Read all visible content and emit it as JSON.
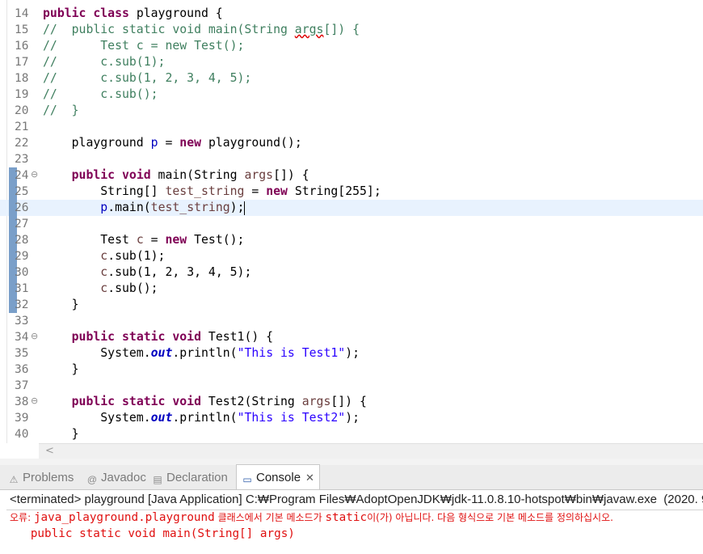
{
  "editor": {
    "current_line": "26",
    "lines": [
      {
        "num": "14",
        "tokens": [
          {
            "t": "kw",
            "v": "public class"
          },
          {
            "t": "p",
            "v": " playground {"
          }
        ]
      },
      {
        "num": "15",
        "tokens": [
          {
            "t": "cm",
            "v": "//  public static void main(String "
          },
          {
            "t": "cmsq",
            "v": "args"
          },
          {
            "t": "cm",
            "v": "[]) {"
          }
        ]
      },
      {
        "num": "16",
        "tokens": [
          {
            "t": "cm",
            "v": "//      Test c = new Test();"
          }
        ]
      },
      {
        "num": "17",
        "tokens": [
          {
            "t": "cm",
            "v": "//      c.sub(1);"
          }
        ]
      },
      {
        "num": "18",
        "tokens": [
          {
            "t": "cm",
            "v": "//      c.sub(1, 2, 3, 4, 5);"
          }
        ]
      },
      {
        "num": "19",
        "tokens": [
          {
            "t": "cm",
            "v": "//      c.sub();"
          }
        ]
      },
      {
        "num": "20",
        "tokens": [
          {
            "t": "cm",
            "v": "//  }"
          }
        ]
      },
      {
        "num": "21",
        "tokens": []
      },
      {
        "num": "22",
        "tokens": [
          {
            "t": "p",
            "v": "    playground "
          },
          {
            "t": "fld",
            "v": "p"
          },
          {
            "t": "p",
            "v": " = "
          },
          {
            "t": "kw",
            "v": "new"
          },
          {
            "t": "p",
            "v": " playground();"
          }
        ]
      },
      {
        "num": "23",
        "tokens": []
      },
      {
        "num": "24",
        "fold": true,
        "marker": true,
        "tokens": [
          {
            "t": "p",
            "v": "    "
          },
          {
            "t": "kw",
            "v": "public void"
          },
          {
            "t": "p",
            "v": " main(String "
          },
          {
            "t": "var",
            "v": "args"
          },
          {
            "t": "p",
            "v": "[]) {"
          }
        ]
      },
      {
        "num": "25",
        "marker": true,
        "tokens": [
          {
            "t": "p",
            "v": "        String[] "
          },
          {
            "t": "var",
            "v": "test_string"
          },
          {
            "t": "p",
            "v": " = "
          },
          {
            "t": "kw",
            "v": "new"
          },
          {
            "t": "p",
            "v": " String[255];"
          }
        ]
      },
      {
        "num": "26",
        "marker": true,
        "current": true,
        "tokens": [
          {
            "t": "p",
            "v": "        "
          },
          {
            "t": "fld",
            "v": "p"
          },
          {
            "t": "p",
            "v": ".main("
          },
          {
            "t": "var",
            "v": "test_string"
          },
          {
            "t": "p",
            "v": ");"
          },
          {
            "t": "caret",
            "v": ""
          }
        ]
      },
      {
        "num": "27",
        "marker": true,
        "tokens": []
      },
      {
        "num": "28",
        "marker": true,
        "tokens": [
          {
            "t": "p",
            "v": "        Test "
          },
          {
            "t": "var",
            "v": "c"
          },
          {
            "t": "p",
            "v": " = "
          },
          {
            "t": "kw",
            "v": "new"
          },
          {
            "t": "p",
            "v": " Test();"
          }
        ]
      },
      {
        "num": "29",
        "marker": true,
        "tokens": [
          {
            "t": "p",
            "v": "        "
          },
          {
            "t": "var",
            "v": "c"
          },
          {
            "t": "p",
            "v": ".sub(1);"
          }
        ]
      },
      {
        "num": "30",
        "marker": true,
        "tokens": [
          {
            "t": "p",
            "v": "        "
          },
          {
            "t": "var",
            "v": "c"
          },
          {
            "t": "p",
            "v": ".sub(1, 2, 3, 4, 5);"
          }
        ]
      },
      {
        "num": "31",
        "marker": true,
        "tokens": [
          {
            "t": "p",
            "v": "        "
          },
          {
            "t": "var",
            "v": "c"
          },
          {
            "t": "p",
            "v": ".sub();"
          }
        ]
      },
      {
        "num": "32",
        "marker": true,
        "tokens": [
          {
            "t": "p",
            "v": "    }"
          }
        ]
      },
      {
        "num": "33",
        "tokens": []
      },
      {
        "num": "34",
        "fold": true,
        "tokens": [
          {
            "t": "p",
            "v": "    "
          },
          {
            "t": "kw",
            "v": "public static void"
          },
          {
            "t": "p",
            "v": " Test1() {"
          }
        ]
      },
      {
        "num": "35",
        "tokens": [
          {
            "t": "p",
            "v": "        System."
          },
          {
            "t": "st",
            "v": "out"
          },
          {
            "t": "p",
            "v": ".println("
          },
          {
            "t": "str",
            "v": "\"This is Test1\""
          },
          {
            "t": "p",
            "v": ");"
          }
        ]
      },
      {
        "num": "36",
        "tokens": [
          {
            "t": "p",
            "v": "    }"
          }
        ]
      },
      {
        "num": "37",
        "tokens": []
      },
      {
        "num": "38",
        "fold": true,
        "tokens": [
          {
            "t": "p",
            "v": "    "
          },
          {
            "t": "kw",
            "v": "public static void"
          },
          {
            "t": "p",
            "v": " Test2(String "
          },
          {
            "t": "var",
            "v": "args"
          },
          {
            "t": "p",
            "v": "[]) {"
          }
        ]
      },
      {
        "num": "39",
        "tokens": [
          {
            "t": "p",
            "v": "        System."
          },
          {
            "t": "st",
            "v": "out"
          },
          {
            "t": "p",
            "v": ".println("
          },
          {
            "t": "str",
            "v": "\"This is Test2\""
          },
          {
            "t": "p",
            "v": ");"
          }
        ]
      },
      {
        "num": "40",
        "tokens": [
          {
            "t": "p",
            "v": "    }"
          }
        ]
      }
    ],
    "hscroll_left_glyph": "<"
  },
  "views": {
    "tabs": [
      {
        "name": "tab-problems",
        "icon": "problems-icon",
        "glyph": "⚠",
        "label": "Problems",
        "active": false
      },
      {
        "name": "tab-javadoc",
        "icon": "javadoc-icon",
        "glyph": "@",
        "label": "Javadoc",
        "active": false
      },
      {
        "name": "tab-declaration",
        "icon": "declaration-icon",
        "glyph": "▤",
        "label": "Declaration",
        "active": false
      },
      {
        "name": "tab-console",
        "icon": "console-icon",
        "glyph": "▭",
        "label": "Console",
        "active": true,
        "close": "✕"
      }
    ]
  },
  "console": {
    "header": "<terminated> playground [Java Application] C:₩Program Files₩AdoptOpenJDK₩jdk-11.0.8.10-hotspot₩bin₩javaw.exe  (2020. 9",
    "error_prefix": "오류: ",
    "error_class": "java_playground.playground",
    "error_msg1": " 클래스에서 기본 메소드가 ",
    "error_static": "static",
    "error_msg2": "이(가) 아닙니다. 다음 형식으로 기본 메소드를 정의하십시오.",
    "error_line2": "   public static void main(String[] args)"
  },
  "colors": {
    "keyword": "#7f0055",
    "comment": "#3f7f5f",
    "string": "#2a00ff",
    "field": "#0000c0",
    "local_var": "#6a3e3e",
    "error": "#e01010",
    "current_line": "#e8f2fe"
  }
}
